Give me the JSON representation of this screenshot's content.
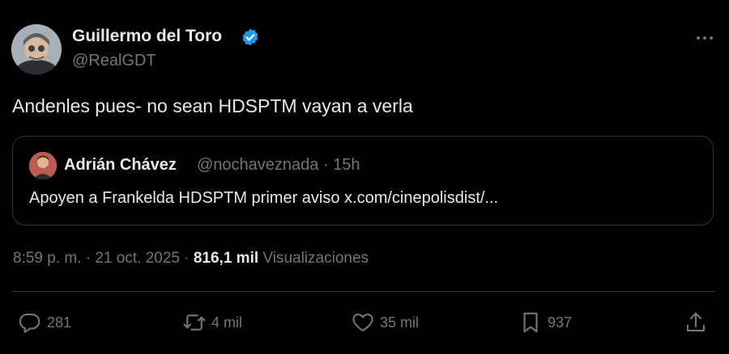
{
  "author": {
    "name": "Guillermo del Toro",
    "handle": "@RealGDT",
    "verified": true
  },
  "tweet": {
    "text": "Andenles pues- no sean HDSPTM vayan a verla"
  },
  "quoted": {
    "name": "Adrián Chávez",
    "handle_time": "@nochaveznada · 15h",
    "text": "Apoyen a Frankelda HDSPTM primer aviso x.com/cinepolisdist/..."
  },
  "meta": {
    "time_date": "8:59 p. m. · 21 oct. 2025 · ",
    "views_count": "816,1 mil",
    "views_label": " Visualizaciones"
  },
  "actions": {
    "replies": "281",
    "retweets": "4 mil",
    "likes": "35 mil",
    "bookmarks": "937"
  },
  "icons": {
    "more": "more-horizontal-icon",
    "verified": "verified-badge-icon",
    "reply": "reply-icon",
    "retweet": "retweet-icon",
    "like": "heart-icon",
    "bookmark": "bookmark-icon",
    "share": "share-icon"
  },
  "colors": {
    "background": "#000000",
    "text": "#e7e9ea",
    "muted": "#71767b",
    "border": "#2f3336",
    "verified": "#1d9bf0"
  }
}
